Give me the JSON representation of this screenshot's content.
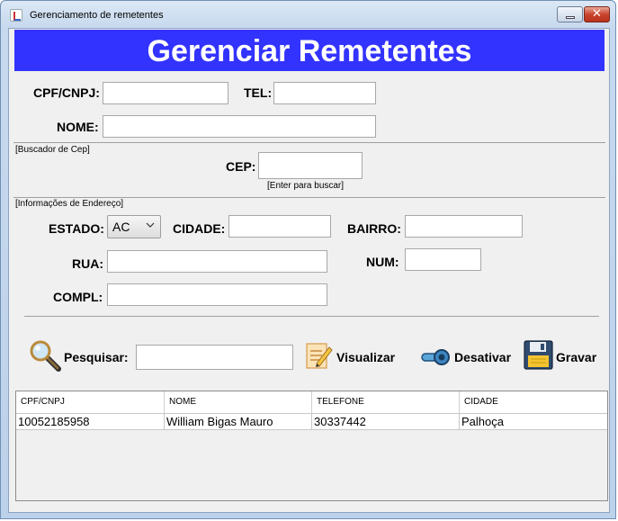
{
  "window": {
    "title": "Gerenciamento de remetentes"
  },
  "banner": {
    "title": "Gerenciar Remetentes"
  },
  "form": {
    "cpf_label": "CPF/CNPJ:",
    "cpf_value": "",
    "tel_label": "TEL:",
    "tel_value": "",
    "nome_label": "NOME:",
    "nome_value": ""
  },
  "cep_section": {
    "heading": "[Buscador de Cep]",
    "cep_label": "CEP:",
    "cep_value": "",
    "hint": "[Enter para buscar]"
  },
  "address": {
    "heading": "[Informações de Endereço]",
    "estado_label": "ESTADO:",
    "estado_value": "AC",
    "cidade_label": "CIDADE:",
    "cidade_value": "",
    "bairro_label": "BAIRRO:",
    "bairro_value": "",
    "rua_label": "RUA:",
    "rua_value": "",
    "num_label": "NUM:",
    "num_value": "",
    "compl_label": "COMPL:",
    "compl_value": ""
  },
  "actions": {
    "search_label": "Pesquisar:",
    "search_value": "",
    "view_label": "Visualizar",
    "deactivate_label": "Desativar",
    "save_label": "Gravar"
  },
  "table": {
    "columns": [
      "CPF/CNPJ",
      "NOME",
      "TELEFONE",
      "CIDADE"
    ],
    "rows": [
      [
        "10052185958",
        "William Bigas Mauro",
        "30337442",
        "Palhoça"
      ]
    ]
  },
  "icons": {
    "app": "java-cup-icon",
    "search": "magnifier-icon",
    "view": "notepad-pencil-icon",
    "deactivate": "key-toggle-icon",
    "save": "floppy-disk-icon"
  },
  "colors": {
    "banner_bg": "#3333ff",
    "banner_text": "#ffffff"
  }
}
